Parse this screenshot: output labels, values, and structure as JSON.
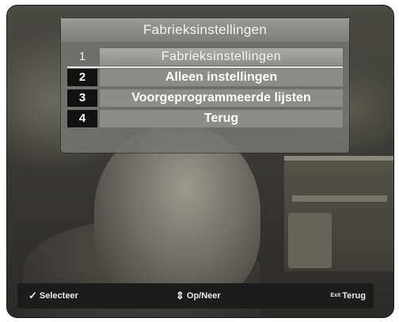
{
  "menu": {
    "title": "Fabrieksinstellingen",
    "items": [
      {
        "number": "1",
        "label": "Fabrieksinstellingen",
        "selected": true
      },
      {
        "number": "2",
        "label": "Alleen instellingen",
        "selected": false
      },
      {
        "number": "3",
        "label": "Voorgeprogrammeerde lijsten",
        "selected": false
      },
      {
        "number": "4",
        "label": "Terug",
        "selected": false
      }
    ]
  },
  "help_bar": {
    "select_icon": "check-icon",
    "select_label": "Selecteer",
    "updown_icon": "up-down-arrows-icon",
    "updown_label": "Op/Neer",
    "back_key": "Exit",
    "back_label": "Terug"
  }
}
